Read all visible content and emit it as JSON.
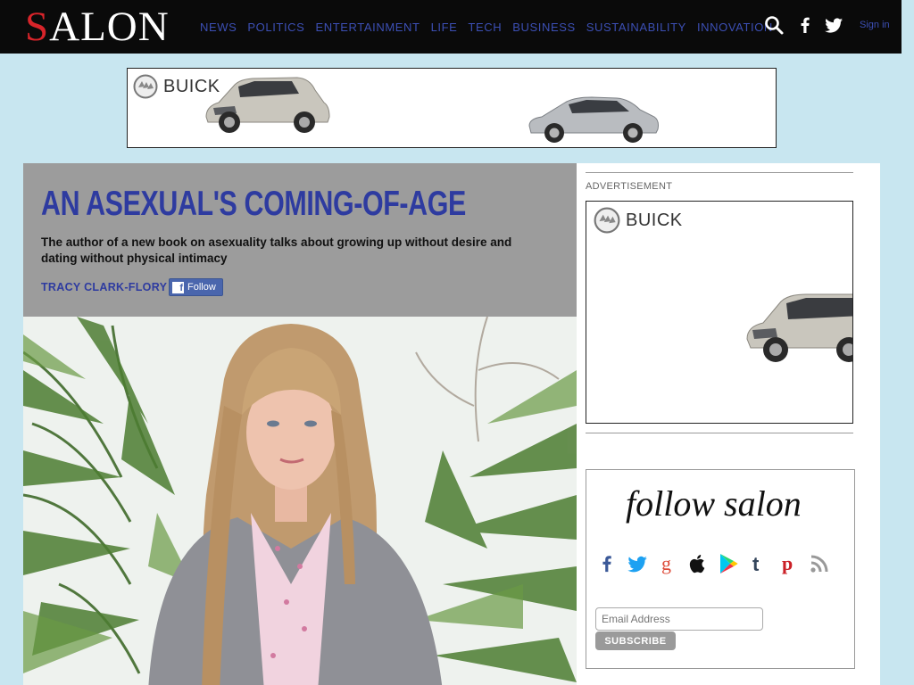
{
  "header": {
    "logo": "SALON",
    "nav": [
      "NEWS",
      "POLITICS",
      "ENTERTAINMENT",
      "LIFE",
      "TECH",
      "BUSINESS",
      "SUSTAINABILITY",
      "INNOVATION"
    ],
    "signin": "Sign in",
    "icons": [
      "search-icon",
      "facebook-icon",
      "twitter-icon"
    ]
  },
  "ads": {
    "top_brand": "BUICK",
    "side_label": "ADVERTISEMENT",
    "side_brand": "BUICK"
  },
  "article": {
    "headline": "AN ASEXUAL'S COMING-OF-AGE",
    "dek": "The author of a new book on asexuality talks about growing up without desire and dating without physical intimacy",
    "author": "TRACY CLARK-FLORY",
    "follow_label": "Follow"
  },
  "follow_box": {
    "title": "follow salon",
    "icons": [
      "facebook-icon",
      "twitter-icon",
      "google-icon",
      "apple-icon",
      "google-play-icon",
      "tumblr-icon",
      "pinterest-icon",
      "rss-icon"
    ],
    "email_placeholder": "Email Address",
    "subscribe_label": "SUBSCRIBE"
  },
  "colors": {
    "page_bg": "#c8e6f0",
    "header_bg": "#0a0a0a",
    "nav_link": "#3c4fb4",
    "logo_accent": "#d8242a",
    "headline": "#2e3ba0",
    "hero_bg": "#9c9c9c"
  }
}
